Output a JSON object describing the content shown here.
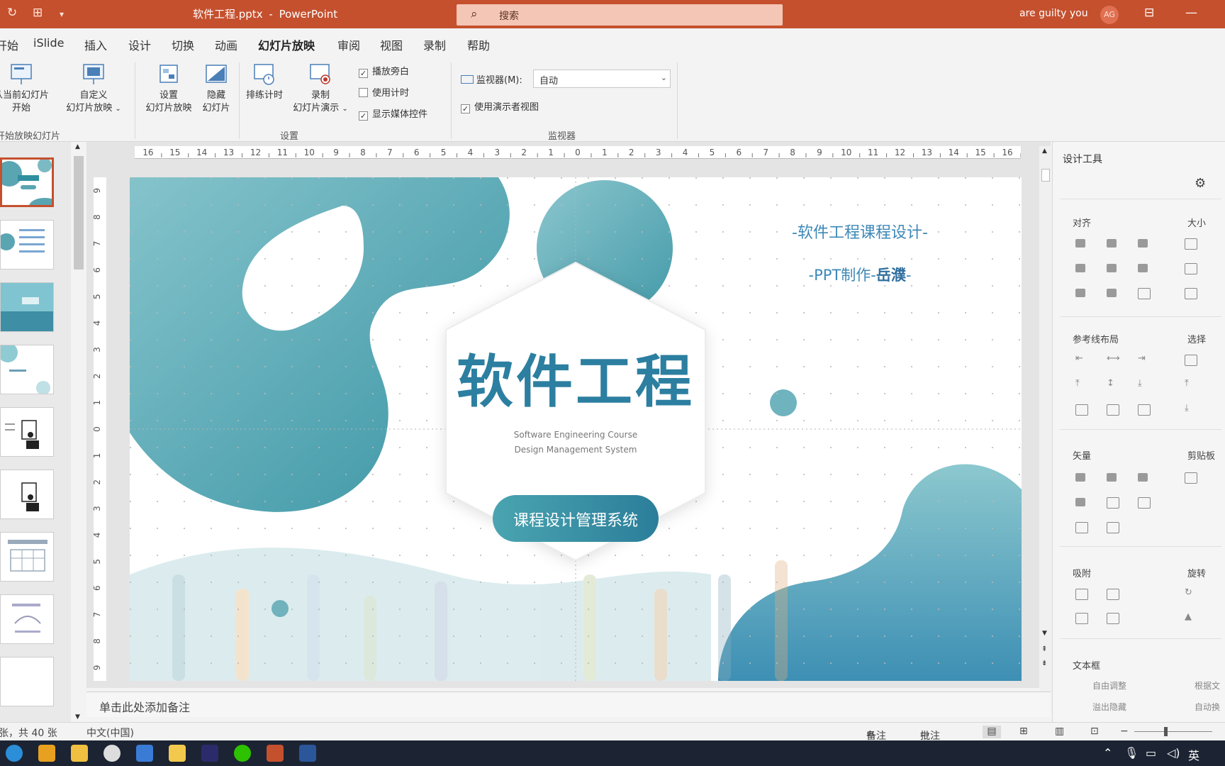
{
  "titlebar": {
    "file_title": "软件工程.pptx",
    "separator": "-",
    "app_name": "PowerPoint",
    "search_placeholder": "搜索",
    "user_name": "are guilty you",
    "avatar_initials": "AG",
    "brand_color": "#c5502e"
  },
  "tabs": [
    {
      "label": "开始"
    },
    {
      "label": "iSlide"
    },
    {
      "label": "插入"
    },
    {
      "label": "设计"
    },
    {
      "label": "切换"
    },
    {
      "label": "动画"
    },
    {
      "label": "幻灯片放映",
      "active": true
    },
    {
      "label": "审阅"
    },
    {
      "label": "视图"
    },
    {
      "label": "录制"
    },
    {
      "label": "帮助"
    }
  ],
  "ribbon": {
    "from_current_line1": "从当前幻灯片",
    "from_current_line2": "开始",
    "custom_line1": "自定义",
    "custom_line2": "幻灯片放映",
    "setup_line1": "设置",
    "setup_line2": "幻灯片放映",
    "hide_line1": "隐藏",
    "hide_line2": "幻灯片",
    "rehearse": "排练计时",
    "record_line1": "录制",
    "record_line2": "幻灯片演示",
    "cb_narration": "播放旁白",
    "cb_narration_checked": true,
    "cb_timings": "使用计时",
    "cb_timings_checked": false,
    "cb_media": "显示媒体控件",
    "cb_media_checked": true,
    "monitor_label": "监视器(M):",
    "monitor_value": "自动",
    "cb_presenter": "使用演示者视图",
    "cb_presenter_checked": true,
    "group_start": "开始放映幻灯片",
    "group_setup": "设置",
    "group_monitor": "监视器"
  },
  "slide": {
    "top_right_line1": "-软件工程课程设计-",
    "top_right_line2_prefix": "-PPT制作-",
    "top_right_line2_name": "岳濮",
    "top_right_line2_suffix": "-",
    "main_title": "软件工程",
    "subtitle_line1": "Software Engineering Course",
    "subtitle_line2": "Design Management System",
    "pill_text": "课程设计管理系统",
    "teal": "#2f8fa0",
    "teal_light": "#a9d3d8"
  },
  "ruler": {
    "h_ticks": [
      "16",
      "15",
      "14",
      "13",
      "12",
      "11",
      "10",
      "9",
      "8",
      "7",
      "6",
      "5",
      "4",
      "3",
      "2",
      "1",
      "0",
      "1",
      "2",
      "3",
      "4",
      "5",
      "6",
      "7",
      "8",
      "9",
      "10",
      "11",
      "12",
      "13",
      "14",
      "15",
      "16"
    ],
    "v_ticks": [
      "9",
      "8",
      "7",
      "6",
      "5",
      "4",
      "3",
      "2",
      "1",
      "0",
      "1",
      "2",
      "3",
      "4",
      "5",
      "6",
      "7",
      "8",
      "9"
    ]
  },
  "notes_placeholder": "单击此处添加备注",
  "pane": {
    "title": "设计工具",
    "align": "对齐",
    "size": "大小",
    "guides": "参考线布局",
    "select": "选择",
    "vector": "矢量",
    "clipboard": "剪贴板",
    "snap": "吸附",
    "rotate": "旋转",
    "textbox": "文本框",
    "autofit": "自由调整",
    "fit_by_text": "根据文",
    "overflow": "溢出隐藏",
    "auto_wrap": "自动换"
  },
  "status": {
    "slide_count": "张，共 40 张",
    "language": "中文(中国)",
    "notes_btn": "备注",
    "comments_btn": "批注"
  }
}
